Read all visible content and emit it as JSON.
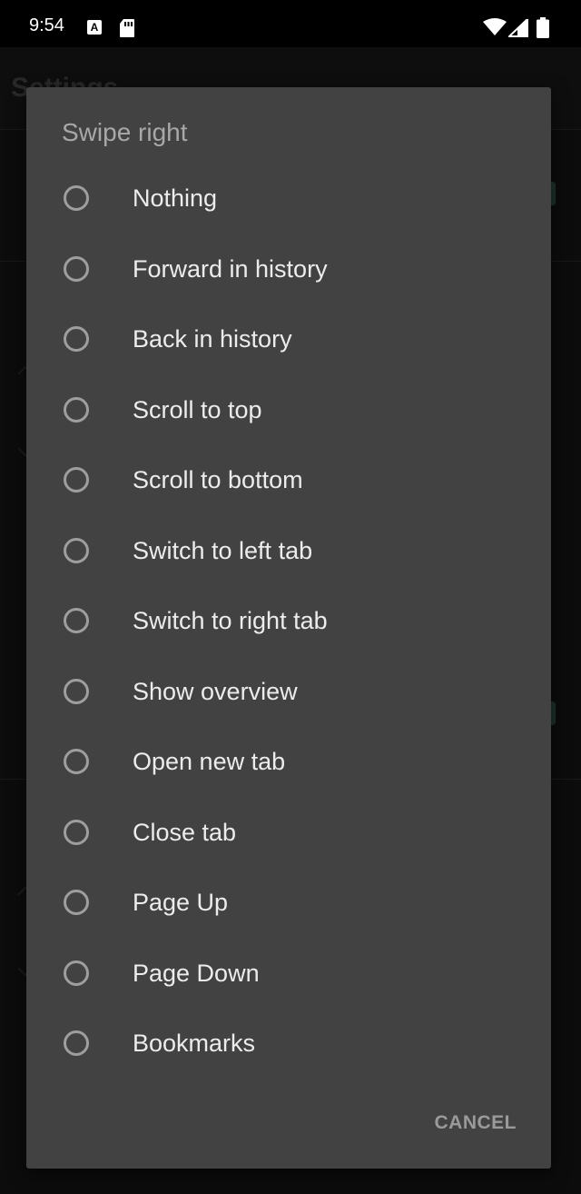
{
  "status_bar": {
    "time": "9:54",
    "icons": [
      "a-notification-icon",
      "sd-card-icon",
      "wifi-icon",
      "signal-icon",
      "battery-icon"
    ]
  },
  "background": {
    "title": "Settings"
  },
  "dialog": {
    "title": "Swipe right",
    "options": [
      {
        "label": "Nothing",
        "selected": false
      },
      {
        "label": "Forward in history",
        "selected": false
      },
      {
        "label": "Back in history",
        "selected": false
      },
      {
        "label": "Scroll to top",
        "selected": false
      },
      {
        "label": "Scroll to bottom",
        "selected": false
      },
      {
        "label": "Switch to left tab",
        "selected": false
      },
      {
        "label": "Switch to right tab",
        "selected": false
      },
      {
        "label": "Show overview",
        "selected": false
      },
      {
        "label": "Open new tab",
        "selected": false
      },
      {
        "label": "Close tab",
        "selected": false
      },
      {
        "label": "Page Up",
        "selected": false
      },
      {
        "label": "Page Down",
        "selected": false
      },
      {
        "label": "Bookmarks",
        "selected": false
      }
    ],
    "cancel_label": "CANCEL"
  },
  "colors": {
    "dialog_bg": "#424242",
    "radio_border": "#9e9e9e",
    "text_primary": "#ececec",
    "title_text": "#a8a8a8"
  }
}
